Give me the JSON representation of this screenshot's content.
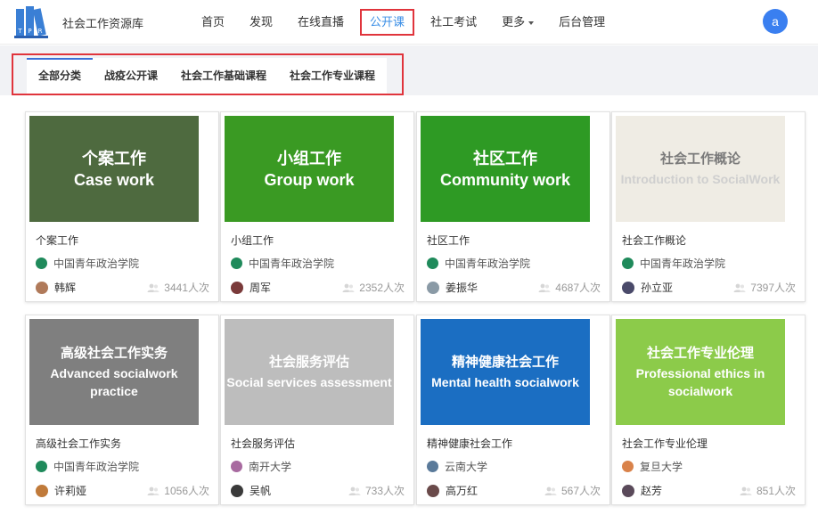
{
  "header": {
    "site_title": "社会工作资源库",
    "logo_letters": [
      "T",
      "P",
      "R"
    ],
    "nav": [
      {
        "label": "首页"
      },
      {
        "label": "发现"
      },
      {
        "label": "在线直播"
      },
      {
        "label": "公开课",
        "active": true
      },
      {
        "label": "社工考试"
      },
      {
        "label": "更多"
      },
      {
        "label": "后台管理"
      }
    ],
    "avatar_letter": "a"
  },
  "categories": {
    "tabs": [
      {
        "label": "全部分类",
        "active": true
      },
      {
        "label": "战疫公开课"
      },
      {
        "label": "社会工作基础课程"
      },
      {
        "label": "社会工作专业课程"
      }
    ]
  },
  "courses": [
    {
      "cover_cn": "个案工作",
      "cover_en": "Case work",
      "cover_color": "#4e6a3f",
      "title": "个案工作",
      "school": "中国青年政治学院",
      "school_icon_color": "#1f8a5b",
      "teacher": "韩辉",
      "teacher_avatar_color": "#b07a5a",
      "views": "3441人次"
    },
    {
      "cover_cn": "小组工作",
      "cover_en": "Group work",
      "cover_color": "#3a9a23",
      "title": "小组工作",
      "school": "中国青年政治学院",
      "school_icon_color": "#1f8a5b",
      "teacher": "周军",
      "teacher_avatar_color": "#7a3a3a",
      "views": "2352人次"
    },
    {
      "cover_cn": "社区工作",
      "cover_en": "Community work",
      "cover_color": "#2e9a24",
      "title": "社区工作",
      "school": "中国青年政治学院",
      "school_icon_color": "#1f8a5b",
      "teacher": "姜振华",
      "teacher_avatar_color": "#8a9aa6",
      "views": "4687人次"
    },
    {
      "cover_cn": "社会工作概论",
      "cover_en": "Introduction to SocialWork",
      "cover_color": "#efece4",
      "light": true,
      "title": "社会工作概论",
      "school": "中国青年政治学院",
      "school_icon_color": "#1f8a5b",
      "teacher": "孙立亚",
      "teacher_avatar_color": "#4a4a6a",
      "views": "7397人次"
    },
    {
      "cover_cn": "高级社会工作实务",
      "cover_en": "Advanced socialwork practice",
      "cover_color": "#7f7f7f",
      "title": "高级社会工作实务",
      "school": "中国青年政治学院",
      "school_icon_color": "#1f8a5b",
      "teacher": "许莉娅",
      "teacher_avatar_color": "#c07a3a",
      "views": "1056人次"
    },
    {
      "cover_cn": "社会服务评估",
      "cover_en": "Social services assessment",
      "cover_color": "#bdbdbd",
      "title": "社会服务评估",
      "school": "南开大学",
      "school_icon_color": "#a86aa0",
      "teacher": "吴帆",
      "teacher_avatar_color": "#3a3a3a",
      "views": "733人次"
    },
    {
      "cover_cn": "精神健康社会工作",
      "cover_en": "Mental health socialwork",
      "cover_color": "#1b6ec2",
      "title": "精神健康社会工作",
      "school": "云南大学",
      "school_icon_color": "#5a7a9a",
      "teacher": "高万红",
      "teacher_avatar_color": "#6a4a4a",
      "views": "567人次"
    },
    {
      "cover_cn": "社会工作专业伦理",
      "cover_en": "Professional ethics in socialwork",
      "cover_color": "#8ccb4a",
      "title": "社会工作专业伦理",
      "school": "复旦大学",
      "school_icon_color": "#d9824a",
      "teacher": "赵芳",
      "teacher_avatar_color": "#5a4a5a",
      "views": "851人次"
    }
  ]
}
